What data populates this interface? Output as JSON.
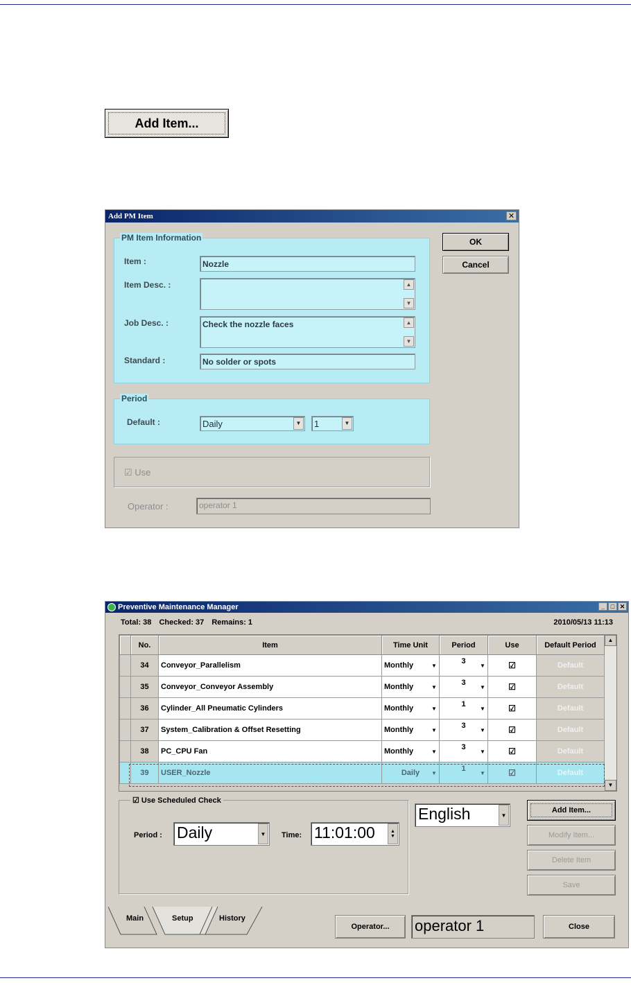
{
  "add_item_standalone": {
    "label": "Add Item..."
  },
  "dialog": {
    "title": "Add PM Item",
    "close_glyph": "✕",
    "pm_info": {
      "legend": "PM Item Information",
      "item_label": "Item :",
      "item_value": "Nozzle",
      "item_desc_label": "Item Desc. :",
      "item_desc_value": "",
      "job_desc_label": "Job Desc. :",
      "job_desc_value": "Check the nozzle faces",
      "standard_label": "Standard :",
      "standard_value": "No solder or spots"
    },
    "period": {
      "legend": "Period",
      "default_label": "Default :",
      "unit_value": "Daily",
      "count_value": "1"
    },
    "use_label": "Use",
    "operator_label": "Operator :",
    "operator_value": "operator 1",
    "ok_label": "OK",
    "cancel_label": "Cancel"
  },
  "pm_manager": {
    "title": "Preventive Maintenance Manager",
    "stats": {
      "total": "Total: 38",
      "checked": "Checked: 37",
      "remains": "Remains: 1"
    },
    "datetime": "2010/05/13 11:13",
    "columns": [
      "No.",
      "Item",
      "Time Unit",
      "Period",
      "Use",
      "Default Period"
    ],
    "rows": [
      {
        "no": "34",
        "item": "Conveyor_Parallelism",
        "unit": "Monthly",
        "period": "3",
        "use": "☑",
        "default": "Default"
      },
      {
        "no": "35",
        "item": "Conveyor_Conveyor Assembly",
        "unit": "Monthly",
        "period": "3",
        "use": "☑",
        "default": "Default"
      },
      {
        "no": "36",
        "item": "Cylinder_All Pneumatic Cylinders",
        "unit": "Monthly",
        "period": "1",
        "use": "☑",
        "default": "Default"
      },
      {
        "no": "37",
        "item": "System_Calibration & Offset Resetting",
        "unit": "Monthly",
        "period": "3",
        "use": "☑",
        "default": "Default"
      },
      {
        "no": "38",
        "item": "PC_CPU Fan",
        "unit": "Monthly",
        "period": "3",
        "use": "☑",
        "default": "Default"
      },
      {
        "no": "39",
        "item": "USER_Nozzle",
        "unit": "Daily",
        "period": "1",
        "use": "☑",
        "default": "Default"
      }
    ],
    "scheduled": {
      "legend": "Use Scheduled Check",
      "period_label": "Period :",
      "period_value": "Daily",
      "time_label": "Time:",
      "time_value": "11:01:00"
    },
    "language": "English",
    "buttons": {
      "add": "Add Item...",
      "modify": "Modify Item...",
      "delete": "Delete Item",
      "save": "Save",
      "operator": "Operator...",
      "close": "Close"
    },
    "operator_value": "operator 1",
    "tabs": [
      "Main",
      "Setup",
      "History"
    ]
  }
}
